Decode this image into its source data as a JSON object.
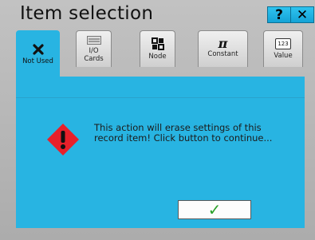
{
  "window": {
    "title": "Item selection",
    "help_label": "?",
    "close_label": "✕"
  },
  "tabs": [
    {
      "label": "Not Used",
      "icon": "x-icon",
      "active": true
    },
    {
      "label": "I/O\nCards",
      "icon": "io-card-icon",
      "active": false
    },
    {
      "label": "Node",
      "icon": "node-icon",
      "active": false
    },
    {
      "label": "Constant",
      "icon": "pi-icon",
      "active": false
    },
    {
      "label": "Value",
      "icon": "value-123-icon",
      "active": false
    }
  ],
  "tab_icons": {
    "value_text": "123",
    "constant_glyph": "π"
  },
  "dialog": {
    "message": "This action will erase settings of this record item! Click button to continue...",
    "confirm_label": "✓"
  },
  "colors": {
    "accent": "#28b4e2",
    "button": "#1fb5e6",
    "warning": "#e8202a",
    "check": "#2aa12a"
  }
}
